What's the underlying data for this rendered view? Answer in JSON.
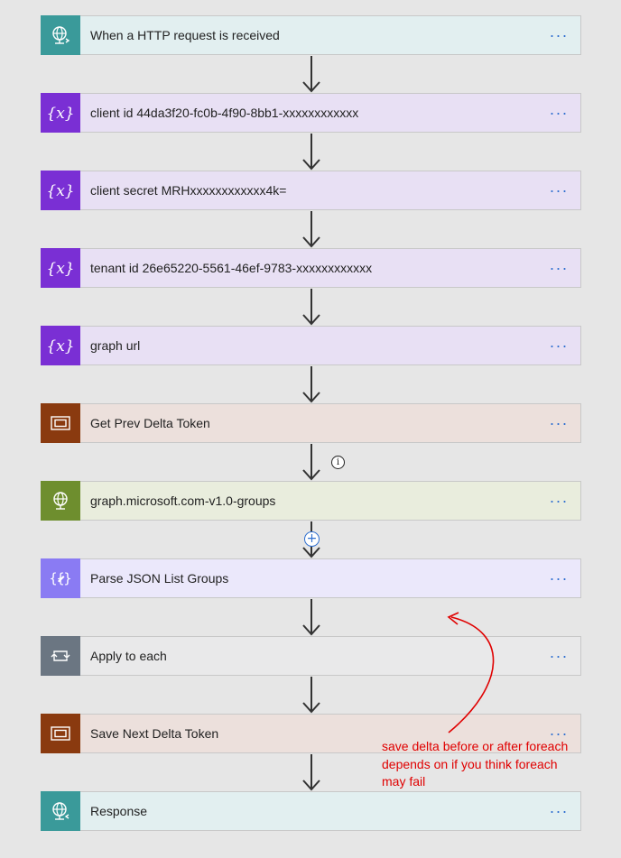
{
  "steps": [
    {
      "label": "When a HTTP request is received",
      "icon": "http-request-globe-icon",
      "color": "#3a9a9a",
      "bg": "#e2eff0"
    },
    {
      "label": "client id 44da3f20-fc0b-4f90-8bb1-xxxxxxxxxxxx",
      "icon": "variable-icon",
      "color": "#7a2fd4",
      "bg": "#e8e0f4"
    },
    {
      "label": "client secret MRHxxxxxxxxxxxx4k=",
      "icon": "variable-icon",
      "color": "#7a2fd4",
      "bg": "#e8e0f4"
    },
    {
      "label": "tenant id 26e65220-5561-46ef-9783-xxxxxxxxxxxx",
      "icon": "variable-icon",
      "color": "#7a2fd4",
      "bg": "#e8e0f4"
    },
    {
      "label": "graph url",
      "icon": "variable-icon",
      "color": "#7a2fd4",
      "bg": "#e8e0f4"
    },
    {
      "label": "Get Prev Delta Token",
      "icon": "compose-icon",
      "color": "#8a3a0f",
      "bg": "#ece0dc"
    },
    {
      "label": "graph.microsoft.com-v1.0-groups",
      "icon": "http-globe-icon",
      "color": "#6e8e2e",
      "bg": "#e9eddd"
    },
    {
      "label": "Parse JSON List Groups",
      "icon": "parse-json-icon",
      "color": "#8a7bf3",
      "bg": "#ebe8fb"
    },
    {
      "label": "Apply to each",
      "icon": "loop-icon",
      "color": "#6b7682",
      "bg": "#e9e9ea"
    },
    {
      "label": "Save Next Delta Token",
      "icon": "compose-icon",
      "color": "#8a3a0f",
      "bg": "#ece0dc"
    },
    {
      "label": "Response",
      "icon": "response-globe-icon",
      "color": "#3a9a9a",
      "bg": "#e2eff0"
    }
  ],
  "menu_label": "···",
  "info_glyph": "i",
  "add_glyph": "+",
  "annotation": {
    "lines": [
      "save delta before or after foreach",
      "depends on if you think foreach",
      "may fail"
    ],
    "color": "#e00000"
  }
}
